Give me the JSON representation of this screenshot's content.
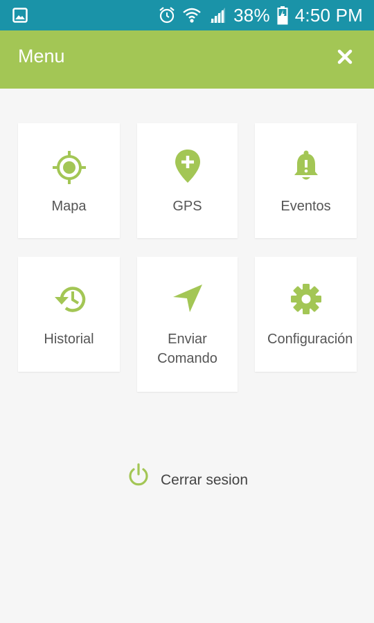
{
  "status_bar": {
    "battery_percent": "38%",
    "time": "4:50 PM",
    "icons": [
      "gallery-icon",
      "alarm-icon",
      "wifi-icon",
      "signal-icon",
      "battery-icon"
    ]
  },
  "header": {
    "title": "Menu",
    "close_icon": "close-icon"
  },
  "colors": {
    "status_bar": "#1a93a8",
    "accent": "#a3c655",
    "background": "#f6f6f6",
    "tile": "#ffffff",
    "text": "#555555"
  },
  "menu": {
    "items": [
      {
        "label": "Mapa",
        "icon": "crosshair-icon"
      },
      {
        "label": "GPS",
        "icon": "map-pin-plus-icon"
      },
      {
        "label": "Eventos",
        "icon": "bell-icon"
      },
      {
        "label": "Historial",
        "icon": "history-icon"
      },
      {
        "label": "Enviar Comando",
        "icon": "navigation-arrow-icon"
      },
      {
        "label": "Configuración",
        "icon": "gear-icon"
      }
    ]
  },
  "logout": {
    "label": "Cerrar sesion",
    "icon": "power-icon"
  }
}
